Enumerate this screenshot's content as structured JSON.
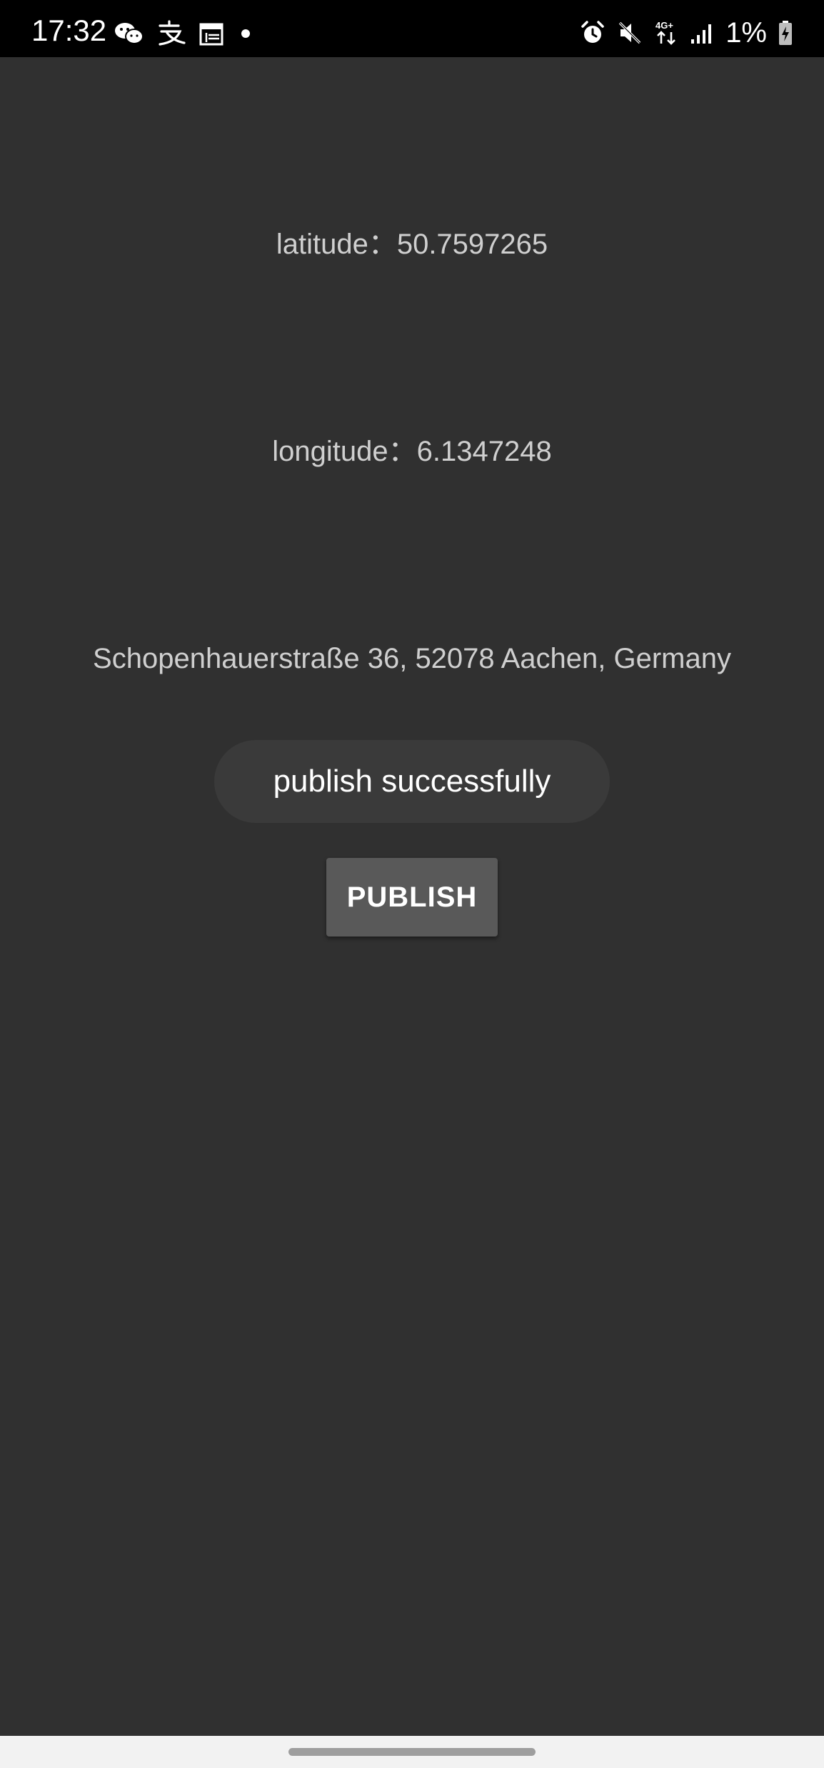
{
  "status_bar": {
    "time": "17:32",
    "battery_percent": "1%",
    "left_icons": [
      "wechat-icon",
      "alipay-icon",
      "calendar-icon",
      "notification-dot-icon"
    ],
    "right_icons": [
      "alarm-icon",
      "mute-icon",
      "4g-data-icon",
      "signal-icon",
      "battery-charging-icon"
    ]
  },
  "location": {
    "latitude_label": "latitude：",
    "latitude_value": "50.7597265",
    "longitude_label": "longitude：",
    "longitude_value": "6.1347248",
    "address": "Schopenhauerstraße 36, 52078 Aachen, Germany"
  },
  "toast": {
    "message": "publish successfully"
  },
  "actions": {
    "publish_label": "PUBLISH"
  },
  "colors": {
    "background": "#303030",
    "status_bar": "#000000",
    "text_secondary": "#cfcfcf",
    "button": "#595959",
    "toast": "#3a3a3a",
    "nav_bar": "#f2f2f2"
  }
}
